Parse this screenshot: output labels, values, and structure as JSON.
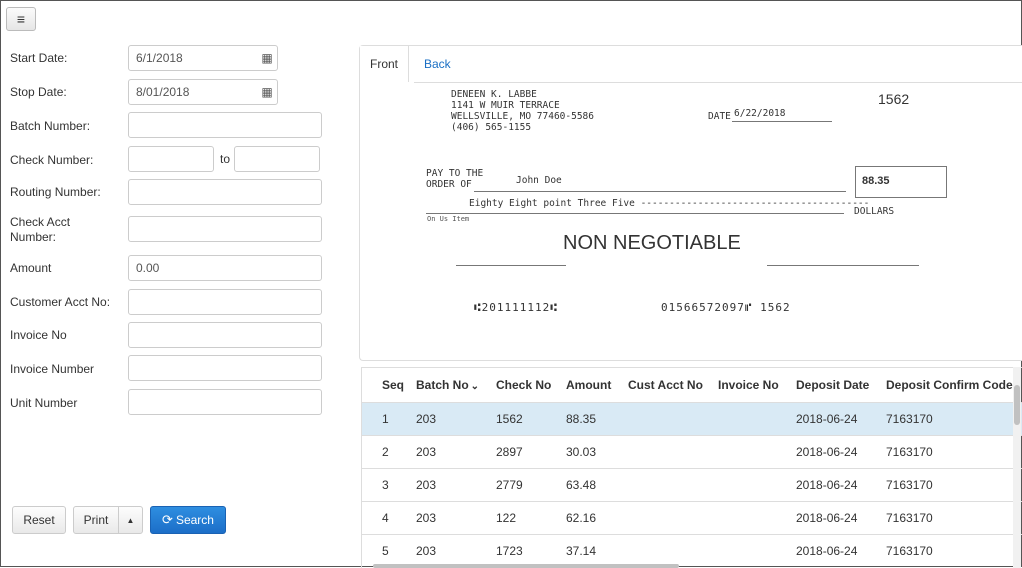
{
  "menu_icon": "hamburger-icon",
  "form": {
    "start_date": {
      "label": "Start Date:",
      "value": "6/1/2018"
    },
    "stop_date": {
      "label": "Stop Date:",
      "value": "8/01/2018"
    },
    "batch_number": {
      "label": "Batch Number:",
      "value": ""
    },
    "check_number": {
      "label": "Check Number:",
      "from": "",
      "to_label": "to",
      "to": ""
    },
    "routing_number": {
      "label": "Routing Number:",
      "value": ""
    },
    "check_acct_number": {
      "label_line1": "Check Acct",
      "label_line2": "Number:",
      "value": ""
    },
    "amount": {
      "label": "Amount",
      "value": "0.00"
    },
    "customer_acct_no": {
      "label": "Customer Acct No:",
      "value": ""
    },
    "invoice_no": {
      "label": "Invoice No",
      "value": ""
    },
    "invoice_number": {
      "label": "Invoice Number",
      "value": ""
    },
    "unit_number": {
      "label": "Unit Number",
      "value": ""
    }
  },
  "buttons": {
    "reset": "Reset",
    "print": "Print",
    "print_caret": "▲",
    "search": "Search"
  },
  "tabs": {
    "front": "Front",
    "back": "Back"
  },
  "check": {
    "payer_name": "DENEEN K. LABBE",
    "payer_address1": "1141 W MUIR TERRACE",
    "payer_address2": "WELLSVILLE, MO 77460-5586",
    "payer_phone": "(406) 565-1155",
    "check_number": "1562",
    "date_label": "DATE",
    "date_value": "6/22/2018",
    "pay_to_line1": "PAY TO THE",
    "pay_to_line2": "ORDER OF",
    "payee": "John Doe",
    "amount": "88.35",
    "amount_words": "Eighty Eight point Three Five ----------------------------------------",
    "dollars_label": "DOLLARS",
    "on_us_label": "On Us Item",
    "non_negotiable": "NON NEGOTIABLE",
    "micr_routing": "⑆201111112⑆",
    "micr_account": "01566572097⑈ 1562"
  },
  "table": {
    "headers": [
      "Seq",
      "Batch No",
      "Check No",
      "Amount",
      "Cust Acct No",
      "Invoice No",
      "Deposit Date",
      "Deposit Confirm Code"
    ],
    "sort_icon": "chevron-down-icon",
    "rows": [
      {
        "seq": "1",
        "batch": "203",
        "check": "1562",
        "amount": "88.35",
        "cust": "",
        "invoice": "",
        "date": "2018-06-24",
        "code": "7163170"
      },
      {
        "seq": "2",
        "batch": "203",
        "check": "2897",
        "amount": "30.03",
        "cust": "",
        "invoice": "",
        "date": "2018-06-24",
        "code": "7163170"
      },
      {
        "seq": "3",
        "batch": "203",
        "check": "2779",
        "amount": "63.48",
        "cust": "",
        "invoice": "",
        "date": "2018-06-24",
        "code": "7163170"
      },
      {
        "seq": "4",
        "batch": "203",
        "check": "122",
        "amount": "62.16",
        "cust": "",
        "invoice": "",
        "date": "2018-06-24",
        "code": "7163170"
      },
      {
        "seq": "5",
        "batch": "203",
        "check": "1723",
        "amount": "37.14",
        "cust": "",
        "invoice": "",
        "date": "2018-06-24",
        "code": "7163170"
      }
    ]
  },
  "colors": {
    "primary": "#1c6ec8",
    "link": "#1a6fc4",
    "selected_row": "#d9eaf5"
  }
}
